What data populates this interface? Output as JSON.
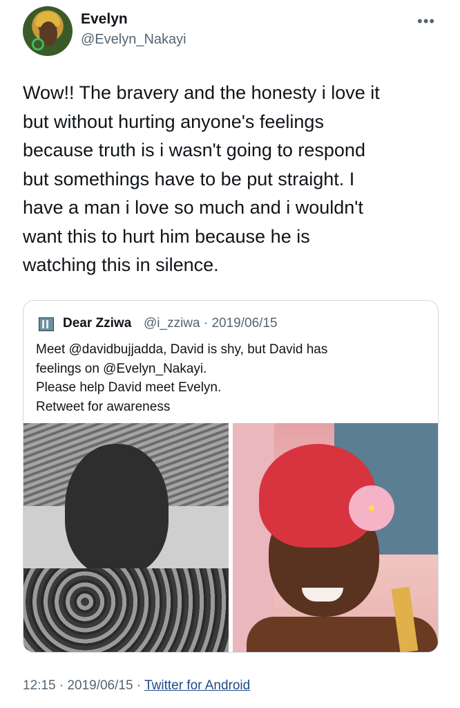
{
  "author": {
    "name": "Evelyn",
    "handle": "@Evelyn_Nakayi"
  },
  "tweet": {
    "text": "Wow!! The bravery and the honesty i love it\nbut without hurting anyone's feelings\nbecause truth is i wasn't going to respond\nbut somethings have to be put straight. I\nhave a man i love so much and i wouldn't\nwant this to hurt him because he is\nwatching this in silence."
  },
  "quoted": {
    "name": "Dear Zziwa",
    "meta": "@i_zziwa · 2019/06/15",
    "text": "Meet @davidbujjadda, David is shy, but David has\nfeelings on @Evelyn_Nakayi.\nPlease help David meet Evelyn.\nRetweet for awareness"
  },
  "footer": {
    "time_date": "12:15 · 2019/06/15 · ",
    "source": "Twitter for Android"
  },
  "icons": {
    "more": "more-horizontal-icon",
    "quoted_avatar": "building-icon"
  }
}
